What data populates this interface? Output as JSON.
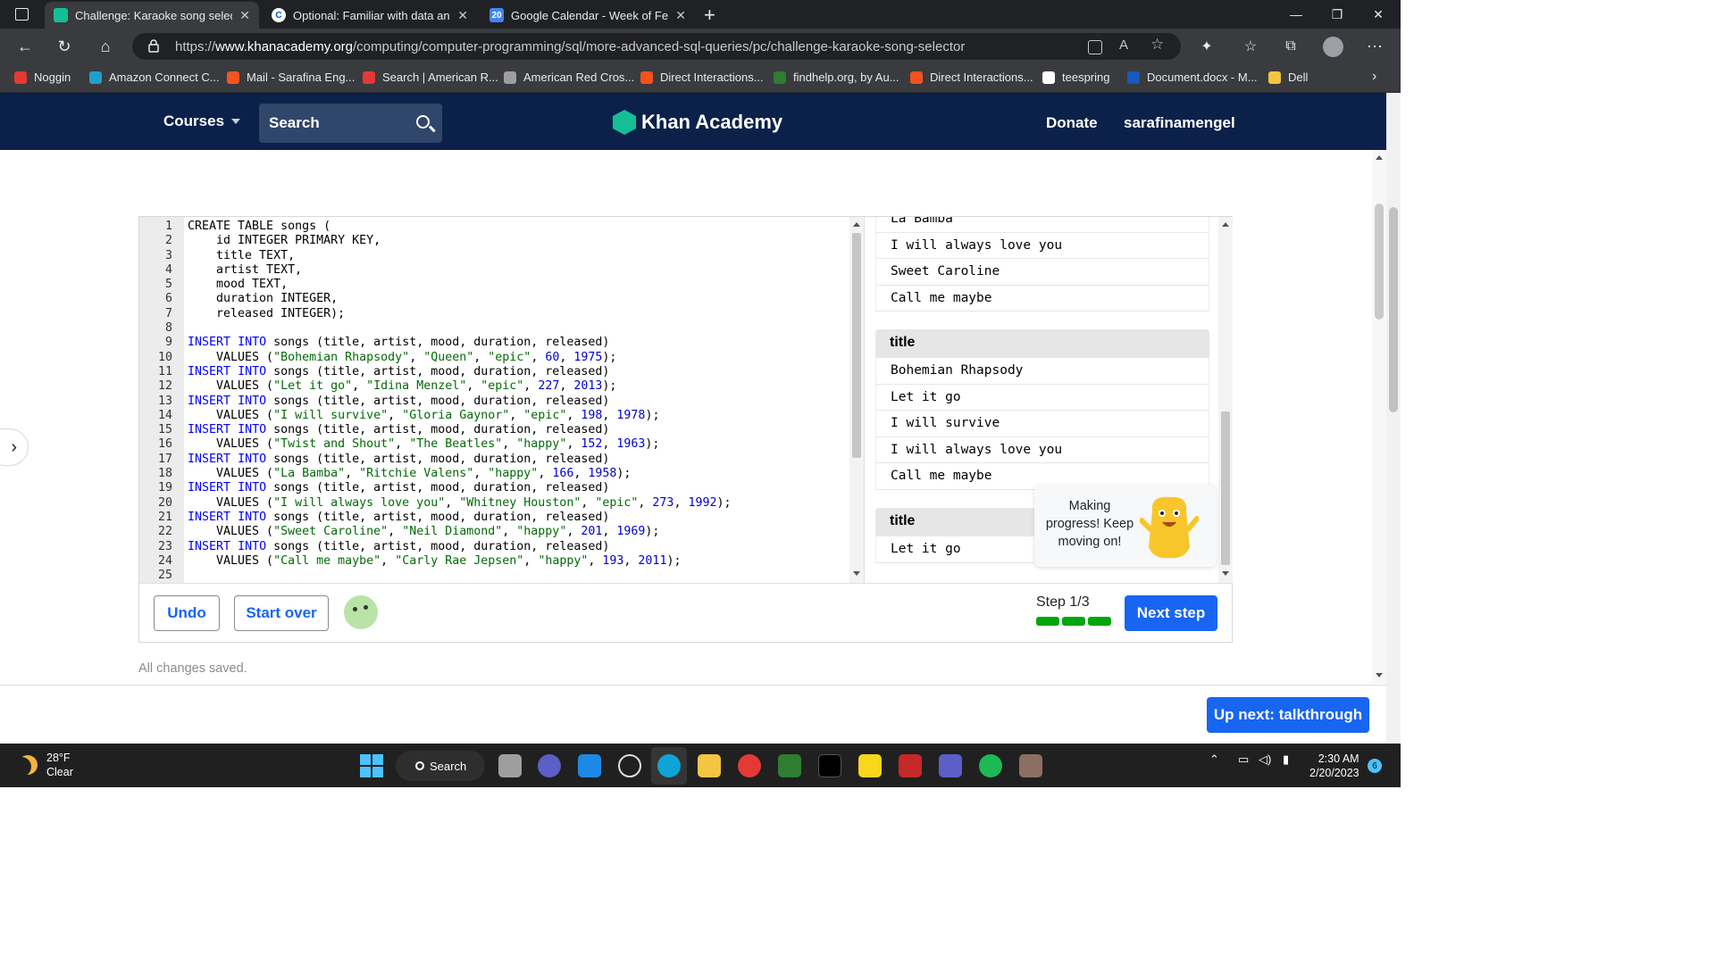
{
  "browser": {
    "tabs": [
      {
        "label": "Challenge: Karaoke song selector",
        "icon": "khan-academy-icon",
        "active": true
      },
      {
        "label": "Optional: Familiar with data analy",
        "icon": "coursera-icon",
        "active": false
      },
      {
        "label": "Google Calendar - Week of Febru",
        "icon": "calendar-icon",
        "active": false
      }
    ],
    "url_prefix": "https://",
    "url_host": "www.khanacademy.org",
    "url_path": "/computing/computer-programming/sql/more-advanced-sql-queries/pc/challenge-karaoke-song-selector",
    "bookmarks": [
      {
        "label": "Noggin",
        "color": "#e53935"
      },
      {
        "label": "Amazon Connect C...",
        "color": "#1fa0c9"
      },
      {
        "label": "Mail - Sarafina Eng...",
        "color": "#f35325"
      },
      {
        "label": "Search | American R...",
        "color": "#e53935"
      },
      {
        "label": "American Red Cros...",
        "color": "#9e9e9e"
      },
      {
        "label": "Direct Interactions...",
        "color": "#f4511e"
      },
      {
        "label": "findhelp.org, by Au...",
        "color": "#2e7d32"
      },
      {
        "label": "Direct Interactions...",
        "color": "#f4511e"
      },
      {
        "label": "teespring",
        "color": "#ffffff"
      },
      {
        "label": "Document.docx - M...",
        "color": "#185abd"
      },
      {
        "label": "Dell",
        "color": "#f4c542"
      }
    ]
  },
  "header": {
    "courses": "Courses",
    "search_placeholder": "Search",
    "logo_text": "Khan Academy",
    "donate": "Donate",
    "username": "sarafinamengel"
  },
  "editor": {
    "lines": [
      "CREATE TABLE songs (",
      "    id INTEGER PRIMARY KEY,",
      "    title TEXT,",
      "    artist TEXT,",
      "    mood TEXT,",
      "    duration INTEGER,",
      "    released INTEGER);",
      "",
      "INSERT INTO songs (title, artist, mood, duration, released)",
      "    VALUES (\"Bohemian Rhapsody\", \"Queen\", \"epic\", 60, 1975);",
      "INSERT INTO songs (title, artist, mood, duration, released)",
      "    VALUES (\"Let it go\", \"Idina Menzel\", \"epic\", 227, 2013);",
      "INSERT INTO songs (title, artist, mood, duration, released)",
      "    VALUES (\"I will survive\", \"Gloria Gaynor\", \"epic\", 198, 1978);",
      "INSERT INTO songs (title, artist, mood, duration, released)",
      "    VALUES (\"Twist and Shout\", \"The Beatles\", \"happy\", 152, 1963);",
      "INSERT INTO songs (title, artist, mood, duration, released)",
      "    VALUES (\"La Bamba\", \"Ritchie Valens\", \"happy\", 166, 1958);",
      "INSERT INTO songs (title, artist, mood, duration, released)",
      "    VALUES (\"I will always love you\", \"Whitney Houston\", \"epic\", 273, 1992);",
      "INSERT INTO songs (title, artist, mood, duration, released)",
      "    VALUES (\"Sweet Caroline\", \"Neil Diamond\", \"happy\", 201, 1969);",
      "INSERT INTO songs (title, artist, mood, duration, released)",
      "    VALUES (\"Call me maybe\", \"Carly Rae Jepsen\", \"happy\", 193, 2011);",
      ""
    ]
  },
  "output": {
    "tables": [
      {
        "header": null,
        "rows": [
          "La Bamba",
          "I will always love you",
          "Sweet Caroline",
          "Call me maybe"
        ]
      },
      {
        "header": "title",
        "rows": [
          "Bohemian Rhapsody",
          "Let it go",
          "I will survive",
          "I will always love you",
          "Call me maybe"
        ]
      },
      {
        "header": "title",
        "rows": [
          "Let it go"
        ]
      }
    ],
    "bubble_text": "Making progress! Keep moving on!"
  },
  "toolbar": {
    "undo": "Undo",
    "start_over": "Start over",
    "step_label": "Step 1/3",
    "steps_completed": 3,
    "next_step": "Next step"
  },
  "status": {
    "saved": "All changes saved."
  },
  "footer": {
    "up_next": "Up next: talkthrough"
  },
  "taskbar": {
    "temp": "28°F",
    "condition": "Clear",
    "search": "Search",
    "time": "2:30 AM",
    "date": "2/20/2023",
    "notifications": "6"
  }
}
